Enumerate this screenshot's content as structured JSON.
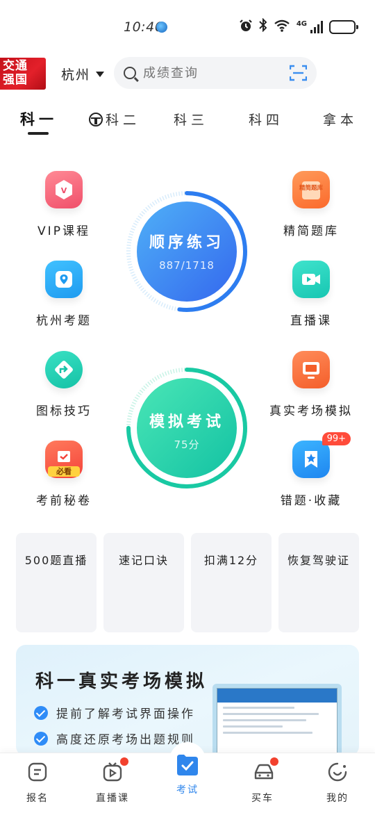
{
  "status_bar": {
    "time": "10:46",
    "network": "4G"
  },
  "header": {
    "logo_line1": "交通",
    "logo_line2": "强国",
    "city": "杭州",
    "search_placeholder": "成绩查询"
  },
  "tabs": [
    {
      "label": "科一",
      "active": true
    },
    {
      "label": "科二",
      "active": false
    },
    {
      "label": "科三",
      "active": false
    },
    {
      "label": "科四",
      "active": false
    },
    {
      "label": "拿本",
      "active": false
    }
  ],
  "features_left": [
    {
      "label": "VIP课程",
      "icon": "vip-icon"
    },
    {
      "label": "杭州考题",
      "icon": "location-icon"
    },
    {
      "label": "图标技巧",
      "icon": "turn-arrow-icon"
    },
    {
      "label": "考前秘卷",
      "icon": "exam-paper-icon",
      "tag": "必看"
    }
  ],
  "features_right": [
    {
      "label": "精简题库",
      "icon": "question-bank-icon",
      "icon_text": "精简题库"
    },
    {
      "label": "直播课",
      "icon": "video-camera-icon"
    },
    {
      "label": "真实考场模拟",
      "icon": "monitor-icon"
    },
    {
      "label": "错题·收藏",
      "icon": "star-bookmark-icon",
      "badge": "99+"
    }
  ],
  "practice": {
    "title": "顺序练习",
    "progress": "887/1718",
    "completion": 0.52
  },
  "mock_exam": {
    "title": "模拟考试",
    "score": "75分",
    "completion": 0.75
  },
  "quick_cards": [
    "500题直播",
    "速记口诀",
    "扣满12分",
    "恢复驾驶证"
  ],
  "banner": {
    "title": "科一真实考场模拟",
    "points": [
      "提前了解考试界面操作",
      "高度还原考场出题规则"
    ]
  },
  "bottom_nav": [
    {
      "label": "报名",
      "icon": "register-icon",
      "dot": false,
      "active": false
    },
    {
      "label": "直播课",
      "icon": "live-tv-icon",
      "dot": true,
      "active": false
    },
    {
      "label": "考试",
      "icon": "exam-check-icon",
      "dot": false,
      "active": true
    },
    {
      "label": "买车",
      "icon": "car-icon",
      "dot": true,
      "active": false
    },
    {
      "label": "我的",
      "icon": "smile-icon",
      "dot": false,
      "active": false
    }
  ],
  "colors": {
    "accent_blue": "#2f86ec",
    "practice_gradient": [
      "#4aa8f5",
      "#3a6ff0"
    ],
    "mock_gradient": [
      "#3fe0b0",
      "#19c8a5"
    ],
    "badge_red": "#ff4b3a"
  }
}
